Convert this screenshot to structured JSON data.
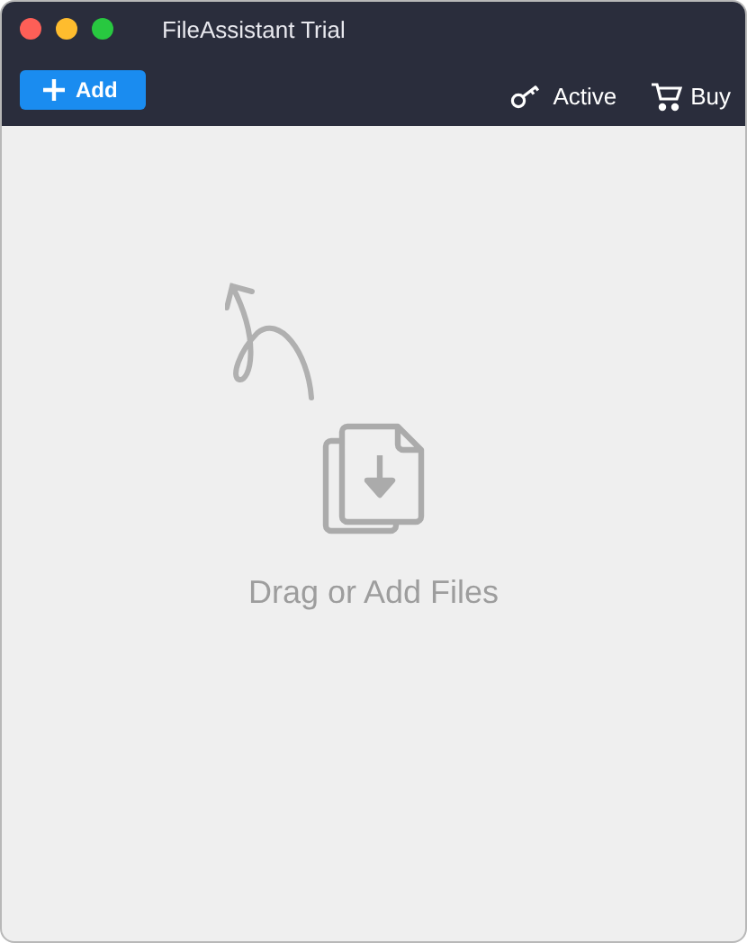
{
  "window": {
    "title": "FileAssistant Trial"
  },
  "toolbar": {
    "add_button": "Add",
    "actions": [
      {
        "kind": "key",
        "label": "Active"
      },
      {
        "kind": "cart",
        "label": "Buy"
      }
    ]
  },
  "drop_area": {
    "message": "Drag or Add Files"
  }
}
